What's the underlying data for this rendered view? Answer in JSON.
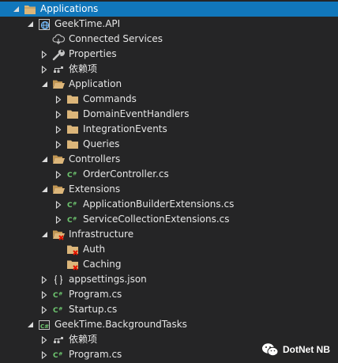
{
  "solution_explorer": {
    "items": [
      {
        "label": "Applications",
        "level": 0,
        "expander": "expanded",
        "icon": "solution-folder-icon",
        "selected": true
      },
      {
        "label": "GeekTime.API",
        "level": 1,
        "expander": "expanded",
        "icon": "web-project-icon"
      },
      {
        "label": "Connected Services",
        "level": 2,
        "expander": "none",
        "icon": "connected-services-icon"
      },
      {
        "label": "Properties",
        "level": 2,
        "expander": "collapsed",
        "icon": "wrench-icon"
      },
      {
        "label": "依赖项",
        "level": 2,
        "expander": "collapsed",
        "icon": "dependencies-icon"
      },
      {
        "label": "Application",
        "level": 2,
        "expander": "expanded",
        "icon": "folder-open-icon"
      },
      {
        "label": "Commands",
        "level": 3,
        "expander": "collapsed",
        "icon": "folder-icon"
      },
      {
        "label": "DomainEventHandlers",
        "level": 3,
        "expander": "collapsed",
        "icon": "folder-icon"
      },
      {
        "label": "IntegrationEvents",
        "level": 3,
        "expander": "collapsed",
        "icon": "folder-icon"
      },
      {
        "label": "Queries",
        "level": 3,
        "expander": "collapsed",
        "icon": "folder-icon"
      },
      {
        "label": "Controllers",
        "level": 2,
        "expander": "expanded",
        "icon": "folder-open-icon"
      },
      {
        "label": "OrderController.cs",
        "level": 3,
        "expander": "collapsed",
        "icon": "csharp-file-icon"
      },
      {
        "label": "Extensions",
        "level": 2,
        "expander": "expanded",
        "icon": "folder-open-icon"
      },
      {
        "label": "ApplicationBuilderExtensions.cs",
        "level": 3,
        "expander": "collapsed",
        "icon": "csharp-file-icon"
      },
      {
        "label": "ServiceCollectionExtensions.cs",
        "level": 3,
        "expander": "collapsed",
        "icon": "csharp-file-icon"
      },
      {
        "label": "Infrastructure",
        "level": 2,
        "expander": "expanded",
        "icon": "folder-open-excluded-icon"
      },
      {
        "label": "Auth",
        "level": 3,
        "expander": "none",
        "icon": "folder-excluded-icon"
      },
      {
        "label": "Caching",
        "level": 3,
        "expander": "none",
        "icon": "folder-excluded-icon"
      },
      {
        "label": "appsettings.json",
        "level": 2,
        "expander": "collapsed",
        "icon": "json-file-icon"
      },
      {
        "label": "Program.cs",
        "level": 2,
        "expander": "collapsed",
        "icon": "csharp-file-icon"
      },
      {
        "label": "Startup.cs",
        "level": 2,
        "expander": "collapsed",
        "icon": "csharp-file-icon"
      },
      {
        "label": "GeekTime.BackgroundTasks",
        "level": 1,
        "expander": "expanded",
        "icon": "csharp-project-icon"
      },
      {
        "label": "依赖项",
        "level": 2,
        "expander": "collapsed",
        "icon": "dependencies-icon"
      },
      {
        "label": "Program.cs",
        "level": 2,
        "expander": "collapsed",
        "icon": "csharp-file-icon"
      }
    ]
  },
  "watermark": {
    "text": "DotNet NB",
    "icon": "wechat-icon"
  },
  "colors": {
    "background": "#252526",
    "selection": "#1177bb",
    "text": "#e6e6e6",
    "folder": "#dcb67a",
    "csharp": "#6ec770",
    "excluded": "#e51400"
  }
}
